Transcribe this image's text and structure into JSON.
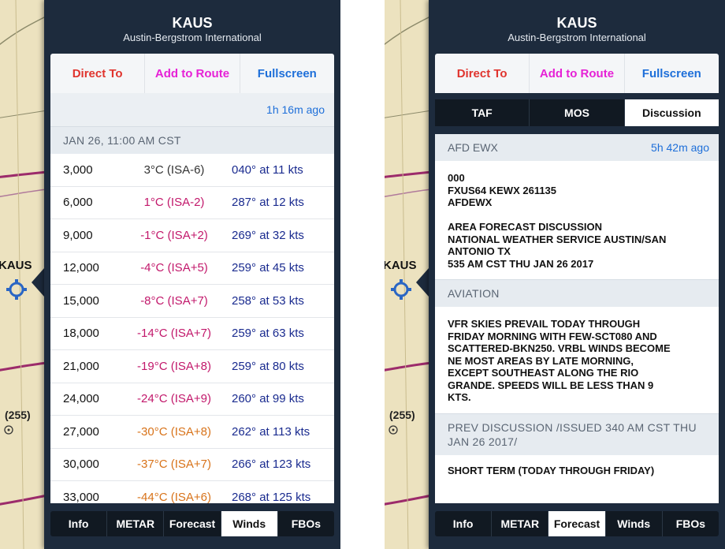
{
  "colors": {
    "panel_bg": "#1d2b3d",
    "direct_to": "#e0342e",
    "add_to_route": "#e621d6",
    "fullscreen": "#1e6fd9",
    "link_blue": "#1e6fd9",
    "wind_text": "#1a2b8f",
    "temp_magenta": "#c2186b",
    "temp_orange": "#d8731a",
    "map_bg": "#ece2bf"
  },
  "map": {
    "airport_label": "KAUS",
    "airway_label": "(255)",
    "airport_icon": "airport-symbol-icon"
  },
  "panel": {
    "title": "KAUS",
    "subtitle": "Austin-Bergstrom International",
    "actions": {
      "direct_to": "Direct To",
      "add_to_route": "Add to Route",
      "fullscreen": "Fullscreen"
    }
  },
  "winds": {
    "updated": "1h 16m ago",
    "date": "JAN 26, 11:00 AM CST",
    "rows": [
      {
        "alt": "3,000",
        "temp": "3°C (ISA-6)",
        "color": "#333333",
        "wind": "040° at 11 kts"
      },
      {
        "alt": "6,000",
        "temp": "1°C (ISA-2)",
        "color": "#c2186b",
        "wind": "287° at 12 kts"
      },
      {
        "alt": "9,000",
        "temp": "-1°C (ISA+2)",
        "color": "#c2186b",
        "wind": "269° at 32 kts"
      },
      {
        "alt": "12,000",
        "temp": "-4°C (ISA+5)",
        "color": "#c2186b",
        "wind": "259° at 45 kts"
      },
      {
        "alt": "15,000",
        "temp": "-8°C (ISA+7)",
        "color": "#c2186b",
        "wind": "258° at 53 kts"
      },
      {
        "alt": "18,000",
        "temp": "-14°C (ISA+7)",
        "color": "#c2186b",
        "wind": "259° at 63 kts"
      },
      {
        "alt": "21,000",
        "temp": "-19°C (ISA+8)",
        "color": "#c2186b",
        "wind": "259° at 80 kts"
      },
      {
        "alt": "24,000",
        "temp": "-24°C (ISA+9)",
        "color": "#c2186b",
        "wind": "260° at 99 kts"
      },
      {
        "alt": "27,000",
        "temp": "-30°C (ISA+8)",
        "color": "#d8731a",
        "wind": "262° at 113 kts"
      },
      {
        "alt": "30,000",
        "temp": "-37°C (ISA+7)",
        "color": "#d8731a",
        "wind": "266° at 123 kts"
      },
      {
        "alt": "33,000",
        "temp": "-44°C (ISA+6)",
        "color": "#d8731a",
        "wind": "268° at 125 kts"
      }
    ]
  },
  "tabs_left": {
    "items": [
      "Info",
      "METAR",
      "Forecast",
      "Winds",
      "FBOs"
    ],
    "selected": "Winds"
  },
  "tabs_right": {
    "items": [
      "Info",
      "METAR",
      "Forecast",
      "Winds",
      "FBOs"
    ],
    "selected": "Forecast"
  },
  "forecast": {
    "subtabs": [
      "TAF",
      "MOS",
      "Discussion"
    ],
    "selected": "Discussion",
    "afd_name": "AFD EWX",
    "afd_ago": "5h 42m ago",
    "header_lines": [
      "000",
      "FXUS64 KEWX 261135",
      "AFDEWX",
      "",
      "AREA FORECAST DISCUSSION",
      "NATIONAL WEATHER SERVICE AUSTIN/SAN",
      "ANTONIO TX",
      "535 AM CST THU JAN 26 2017"
    ],
    "aviation_title": "AVIATION",
    "aviation_lines": [
      "VFR SKIES PREVAIL TODAY THROUGH",
      "FRIDAY MORNING WITH FEW-SCT080 AND",
      "SCATTERED-BKN250. VRBL WINDS BECOME",
      "NE MOST AREAS BY LATE MORNING,",
      "EXCEPT SOUTHEAST ALONG THE RIO",
      "GRANDE. SPEEDS WILL BE LESS THAN 9",
      "KTS."
    ],
    "prev_title": "PREV DISCUSSION  /ISSUED 340 AM CST THU JAN 26 2017/",
    "short_term": "SHORT TERM (TODAY THROUGH FRIDAY)"
  }
}
